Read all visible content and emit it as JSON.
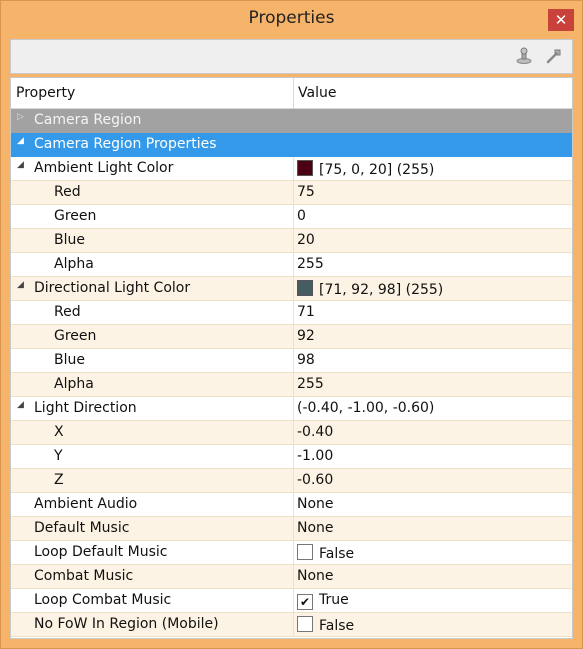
{
  "window": {
    "title": "Properties",
    "close_glyph": "✕"
  },
  "toolbar": {
    "icons": [
      "pin-icon",
      "wrench-icon"
    ]
  },
  "grid": {
    "header": {
      "property": "Property",
      "value": "Value"
    },
    "rows": [
      {
        "kind": "category",
        "expander": "▷",
        "name": "Camera Region",
        "value": ""
      },
      {
        "kind": "selected",
        "expander": "◢",
        "name": "Camera Region Properties",
        "value": ""
      },
      {
        "kind": "group",
        "expander": "◢",
        "name": "Ambient Light Color",
        "value": "[75, 0, 20] (255)",
        "swatch": "#4b0014"
      },
      {
        "kind": "child",
        "name": "Red",
        "value": "75"
      },
      {
        "kind": "child",
        "name": "Green",
        "value": "0"
      },
      {
        "kind": "child",
        "name": "Blue",
        "value": "20"
      },
      {
        "kind": "child",
        "name": "Alpha",
        "value": "255"
      },
      {
        "kind": "group",
        "expander": "◢",
        "name": "Directional Light Color",
        "value": "[71, 92, 98] (255)",
        "swatch": "#475c62"
      },
      {
        "kind": "child",
        "name": "Red",
        "value": "71"
      },
      {
        "kind": "child",
        "name": "Green",
        "value": "92"
      },
      {
        "kind": "child",
        "name": "Blue",
        "value": "98"
      },
      {
        "kind": "child",
        "name": "Alpha",
        "value": "255"
      },
      {
        "kind": "group",
        "expander": "◢",
        "name": "Light Direction",
        "value": "(-0.40, -1.00, -0.60)"
      },
      {
        "kind": "child",
        "name": "X",
        "value": "-0.40"
      },
      {
        "kind": "child",
        "name": "Y",
        "value": "-1.00"
      },
      {
        "kind": "child",
        "name": "Z",
        "value": "-0.60"
      },
      {
        "kind": "item",
        "name": "Ambient Audio",
        "value": "None"
      },
      {
        "kind": "item",
        "name": "Default Music",
        "value": "None"
      },
      {
        "kind": "item",
        "name": "Loop Default Music",
        "value": "False",
        "checkbox": false
      },
      {
        "kind": "item",
        "name": "Combat Music",
        "value": "None"
      },
      {
        "kind": "item",
        "name": "Loop Combat Music",
        "value": "True",
        "checkbox": true
      },
      {
        "kind": "item",
        "name": "No FoW In Region (Mobile)",
        "value": "False",
        "checkbox": false
      }
    ]
  },
  "colors": {
    "window_bg": "#f6b36a",
    "category_bg": "#a2a2a2",
    "selected_bg": "#3399e8",
    "alt_row_bg": "#fdf3e4",
    "close_bg": "#c8413a"
  }
}
